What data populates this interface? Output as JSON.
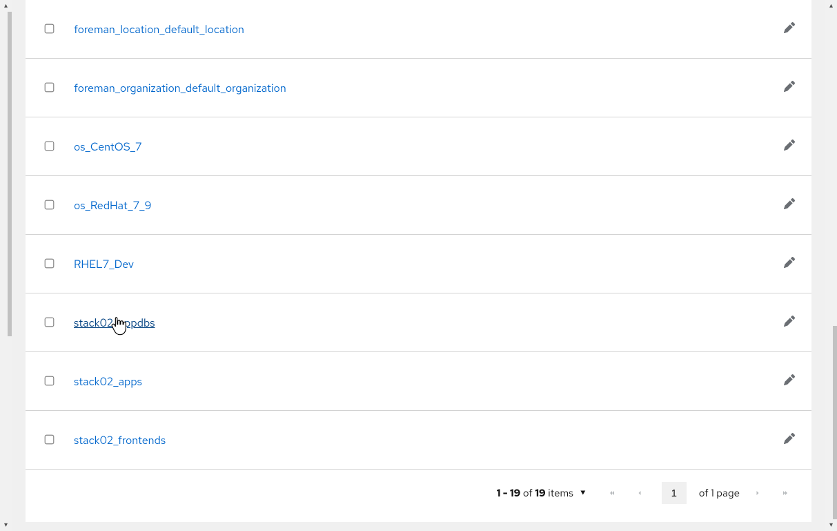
{
  "rows": [
    {
      "name": "foreman_location_default_location",
      "hovered": false
    },
    {
      "name": "foreman_organization_default_organization",
      "hovered": false
    },
    {
      "name": "os_CentOS_7",
      "hovered": false
    },
    {
      "name": "os_RedHat_7_9",
      "hovered": false
    },
    {
      "name": "RHEL7_Dev",
      "hovered": false
    },
    {
      "name": "stack02_appdbs",
      "hovered": true
    },
    {
      "name": "stack02_apps",
      "hovered": false
    },
    {
      "name": "stack02_frontends",
      "hovered": false
    }
  ],
  "pagination": {
    "range_text": "1 - 19",
    "of_word": "of",
    "total_items": "19",
    "items_word": "items",
    "current_page": "1",
    "of_page_text": "of 1 page"
  }
}
